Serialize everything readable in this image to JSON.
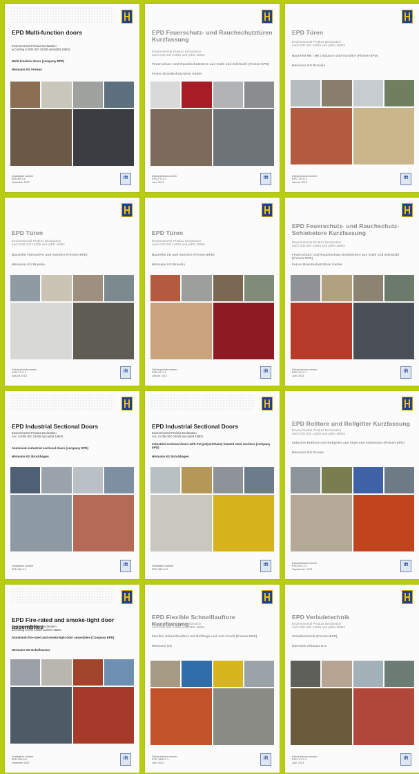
{
  "covers": [
    {
      "title": "EPD Multi-function doors",
      "subtitle": "Environmental Product Declaration\naccording to DIN ISO 14025 and prEN 15804",
      "product": "Multi-function doors (company EPD)",
      "maker": "Hörmann KG Freisen",
      "declaration": "Declaration number\nEPD-MT-3.1\nNovember 2012",
      "ift_label": "ift",
      "blurred": false,
      "photo_colors_top": [
        "#8a6f52",
        "#c9c7bc",
        "#9ea19e",
        "#5c7080"
      ],
      "photo_colors_bottom": [
        "#6b5846",
        "#3a3d42"
      ]
    },
    {
      "title": "EPD Feuerschutz- und Rauchschutztüren Kurzfassung",
      "subtitle": "Environmental Product Declaration\nnach DIN ISO 14025 und prEN 15804",
      "product": "Feuerschutz- und Rauchschutztüren aus Stahl und Edelstahl (Firmen-EPD)",
      "maker": "Fortex Brandschutztüren GmbH",
      "declaration": "Deklarationsnummer\nEPD-FS-0.1\nJuni 2013",
      "ift_label": "ift",
      "blurred": true,
      "photo_colors_top": [
        "#d9d9d9",
        "#a81c25",
        "#b1b3b5",
        "#8a8d90"
      ],
      "photo_colors_bottom": [
        "#7c6a5a",
        "#6e7377"
      ]
    },
    {
      "title": "EPD Türen",
      "subtitle": "Environmental Product Declaration\nnach DIN ISO 14025 und prEN 15804",
      "product": "Baureihe HB / ME | Baustro und Variofire (Firmen-EPD)",
      "maker": "Hörmann KG Brandis",
      "declaration": "Deklarationsnummer\nEPD-TH-0.1\nJanuar 2013",
      "ift_label": "ift",
      "blurred": true,
      "photo_colors_top": [
        "#b7bcc0",
        "#8b7d6c",
        "#c7ccd1",
        "#6f7f5f"
      ],
      "photo_colors_bottom": [
        "#b45a3e",
        "#c9b68b"
      ]
    },
    {
      "title": "EPD Türen",
      "subtitle": "Environmental Product Declaration\nnach DIN ISO 14025 und prEN 15804",
      "product": "Baureihe ThermoPro und Variofire (Firmen-EPD)",
      "maker": "Hörmann KG Brandis",
      "declaration": "Deklarationsnummer\nEPD-TT-0.1\nJanuar 2013",
      "ift_label": "ift",
      "blurred": true,
      "photo_colors_top": [
        "#8f9aa3",
        "#cbc4b4",
        "#9e8f7f",
        "#7b8a8f"
      ],
      "photo_colors_bottom": [
        "#d8d8d6",
        "#5f5c54"
      ]
    },
    {
      "title": "EPD Türen",
      "subtitle": "Environmental Product Declaration\nnach DIN ISO 14025 und prEN 15804",
      "product": "Baureihe ZK und Variofire (Firmen-EPD)",
      "maker": "Hörmann KG Brandis",
      "declaration": "Deklarationsnummer\nEPD-ZT-0.1\nJanuar 2013",
      "ift_label": "ift",
      "blurred": true,
      "photo_colors_top": [
        "#b45a3e",
        "#9c9f9c",
        "#7a6852",
        "#7e8c79"
      ],
      "photo_colors_bottom": [
        "#c8a37c",
        "#8e1a24"
      ]
    },
    {
      "title": "EPD Feuerschutz- und Rauchschutz-Schiebetore Kurzfassung",
      "subtitle": "Environmental Product Declaration\nnach DIN ISO 14025 und prEN 15804",
      "product": "Feuerschutz- und Rauchschutz-Schiebetore aus Stahl und Edelstahl (Firmen-EPD)",
      "maker": "Fortex Brandschutztüren GmbH",
      "declaration": "Deklarationsnummer\nEPD-SC-0.1\nJuni 2013",
      "ift_label": "ift",
      "blurred": true,
      "photo_colors_top": [
        "#8e9195",
        "#b2a17e",
        "#8d8372",
        "#6b7a6a"
      ],
      "photo_colors_bottom": [
        "#b63a2a",
        "#4a4f57"
      ]
    },
    {
      "title": "EPD Industrial Sectional Doors",
      "subtitle": "Environmental Product Declaration\nAcc. to DIN ISO 14025 and prEN 15804",
      "product": "Aluminium industrial sectional doors (company EPD)",
      "maker": "Hörmann KG Brockhagen",
      "declaration": "Declaration number\nEPD-ISA-0.3",
      "ift_label": "ift",
      "blurred": false,
      "photo_colors_top": [
        "#4f6075",
        "#9aa3ab",
        "#b9c0c6",
        "#7d8fa0"
      ],
      "photo_colors_bottom": [
        "#8d9aa3",
        "#b46a55"
      ]
    },
    {
      "title": "EPD Industrial Sectional Doors",
      "subtitle": "Environmental Product Declaration\nAcc. to DIN ISO 14025 and prEN 15804",
      "product": "Industrial sectional doors with PU (polyurethane) foamed steel sections (company EPD)",
      "maker": "Hörmann KG Brockhagen",
      "declaration": "Declaration number\nEPD-ISPU-0.3",
      "ift_label": "ift",
      "blurred": false,
      "photo_colors_top": [
        "#b9c0c4",
        "#b59758",
        "#8e9399",
        "#6d7c8a"
      ],
      "photo_colors_bottom": [
        "#c8c7c0",
        "#d6b21c"
      ]
    },
    {
      "title": "EPD Rolltore und Rollgitter Kurzfassung",
      "subtitle": "Environmental Product Declaration\nnach DIN ISO 14025 und prEN 15804",
      "product": "Industrie Rolltore und Rollgitter aus Stahl und Aluminium (Firmen-EPD)",
      "maker": "Hörmann KG Dissen",
      "declaration": "Deklarationsnummer\nEPD-RG-0.1\nSeptember 2013",
      "ift_label": "ift",
      "blurred": true,
      "photo_colors_top": [
        "#8d949a",
        "#7a7d4e",
        "#3f62a6",
        "#6e7a86"
      ],
      "photo_colors_bottom": [
        "#b3a996",
        "#c2441f"
      ]
    },
    {
      "title": "EPD Fire-rated and smoke-tight door assemblies",
      "subtitle": "Environmental Product Declaration\naccording to ISO 14025 and EN 15804",
      "product": "Aluminium fire-rated and smoke-tight door assemblies (Company EPD)",
      "maker": "Hörmann KG Eckelhausen",
      "declaration": "Declaration number\nEPD-FSA-0.3\nDecember 2012",
      "ift_label": "ift",
      "blurred": false,
      "photo_colors_top": [
        "#9aa0a6",
        "#b9b6b0",
        "#a1442c",
        "#6d8fb1"
      ],
      "photo_colors_bottom": [
        "#4c5b66",
        "#a63a2a"
      ]
    },
    {
      "title": "EPD Flexible Schnelllauftore Kurzfassung",
      "subtitle": "Environmental Product Declaration\nnach DIN ISO 14025 und prEN 15804",
      "product": "Flexible Schnelllauftore mit Rollfolge und Anti-Crash (Firmen-EPD)",
      "maker": "Hörmann KG",
      "declaration": "Deklarationsnummer\nEPD-SBR-0.1\nJuni 2013",
      "ift_label": "ift",
      "blurred": true,
      "photo_colors_top": [
        "#a79a83",
        "#2f6ea8",
        "#d6b51f",
        "#9aa3a8"
      ],
      "photo_colors_bottom": [
        "#c0532a",
        "#8b8b85"
      ]
    },
    {
      "title": "EPD Verladetechnik",
      "subtitle": "Environmental Product Declaration\nnach DIN ISO 14025 und prEN 15804",
      "product": "Verladetechnik (Firmen-EPD)",
      "maker": "Hörmann Alkmaar B.V.",
      "declaration": "Deklarationsnummer\nEPD-VT-0.1\nJuni 2013",
      "ift_label": "ift",
      "blurred": true,
      "photo_colors_top": [
        "#5e5f58",
        "#b6a592",
        "#a3b1b9",
        "#6b7d74"
      ],
      "photo_colors_bottom": [
        "#6b5a3c",
        "#b0473a"
      ]
    }
  ]
}
